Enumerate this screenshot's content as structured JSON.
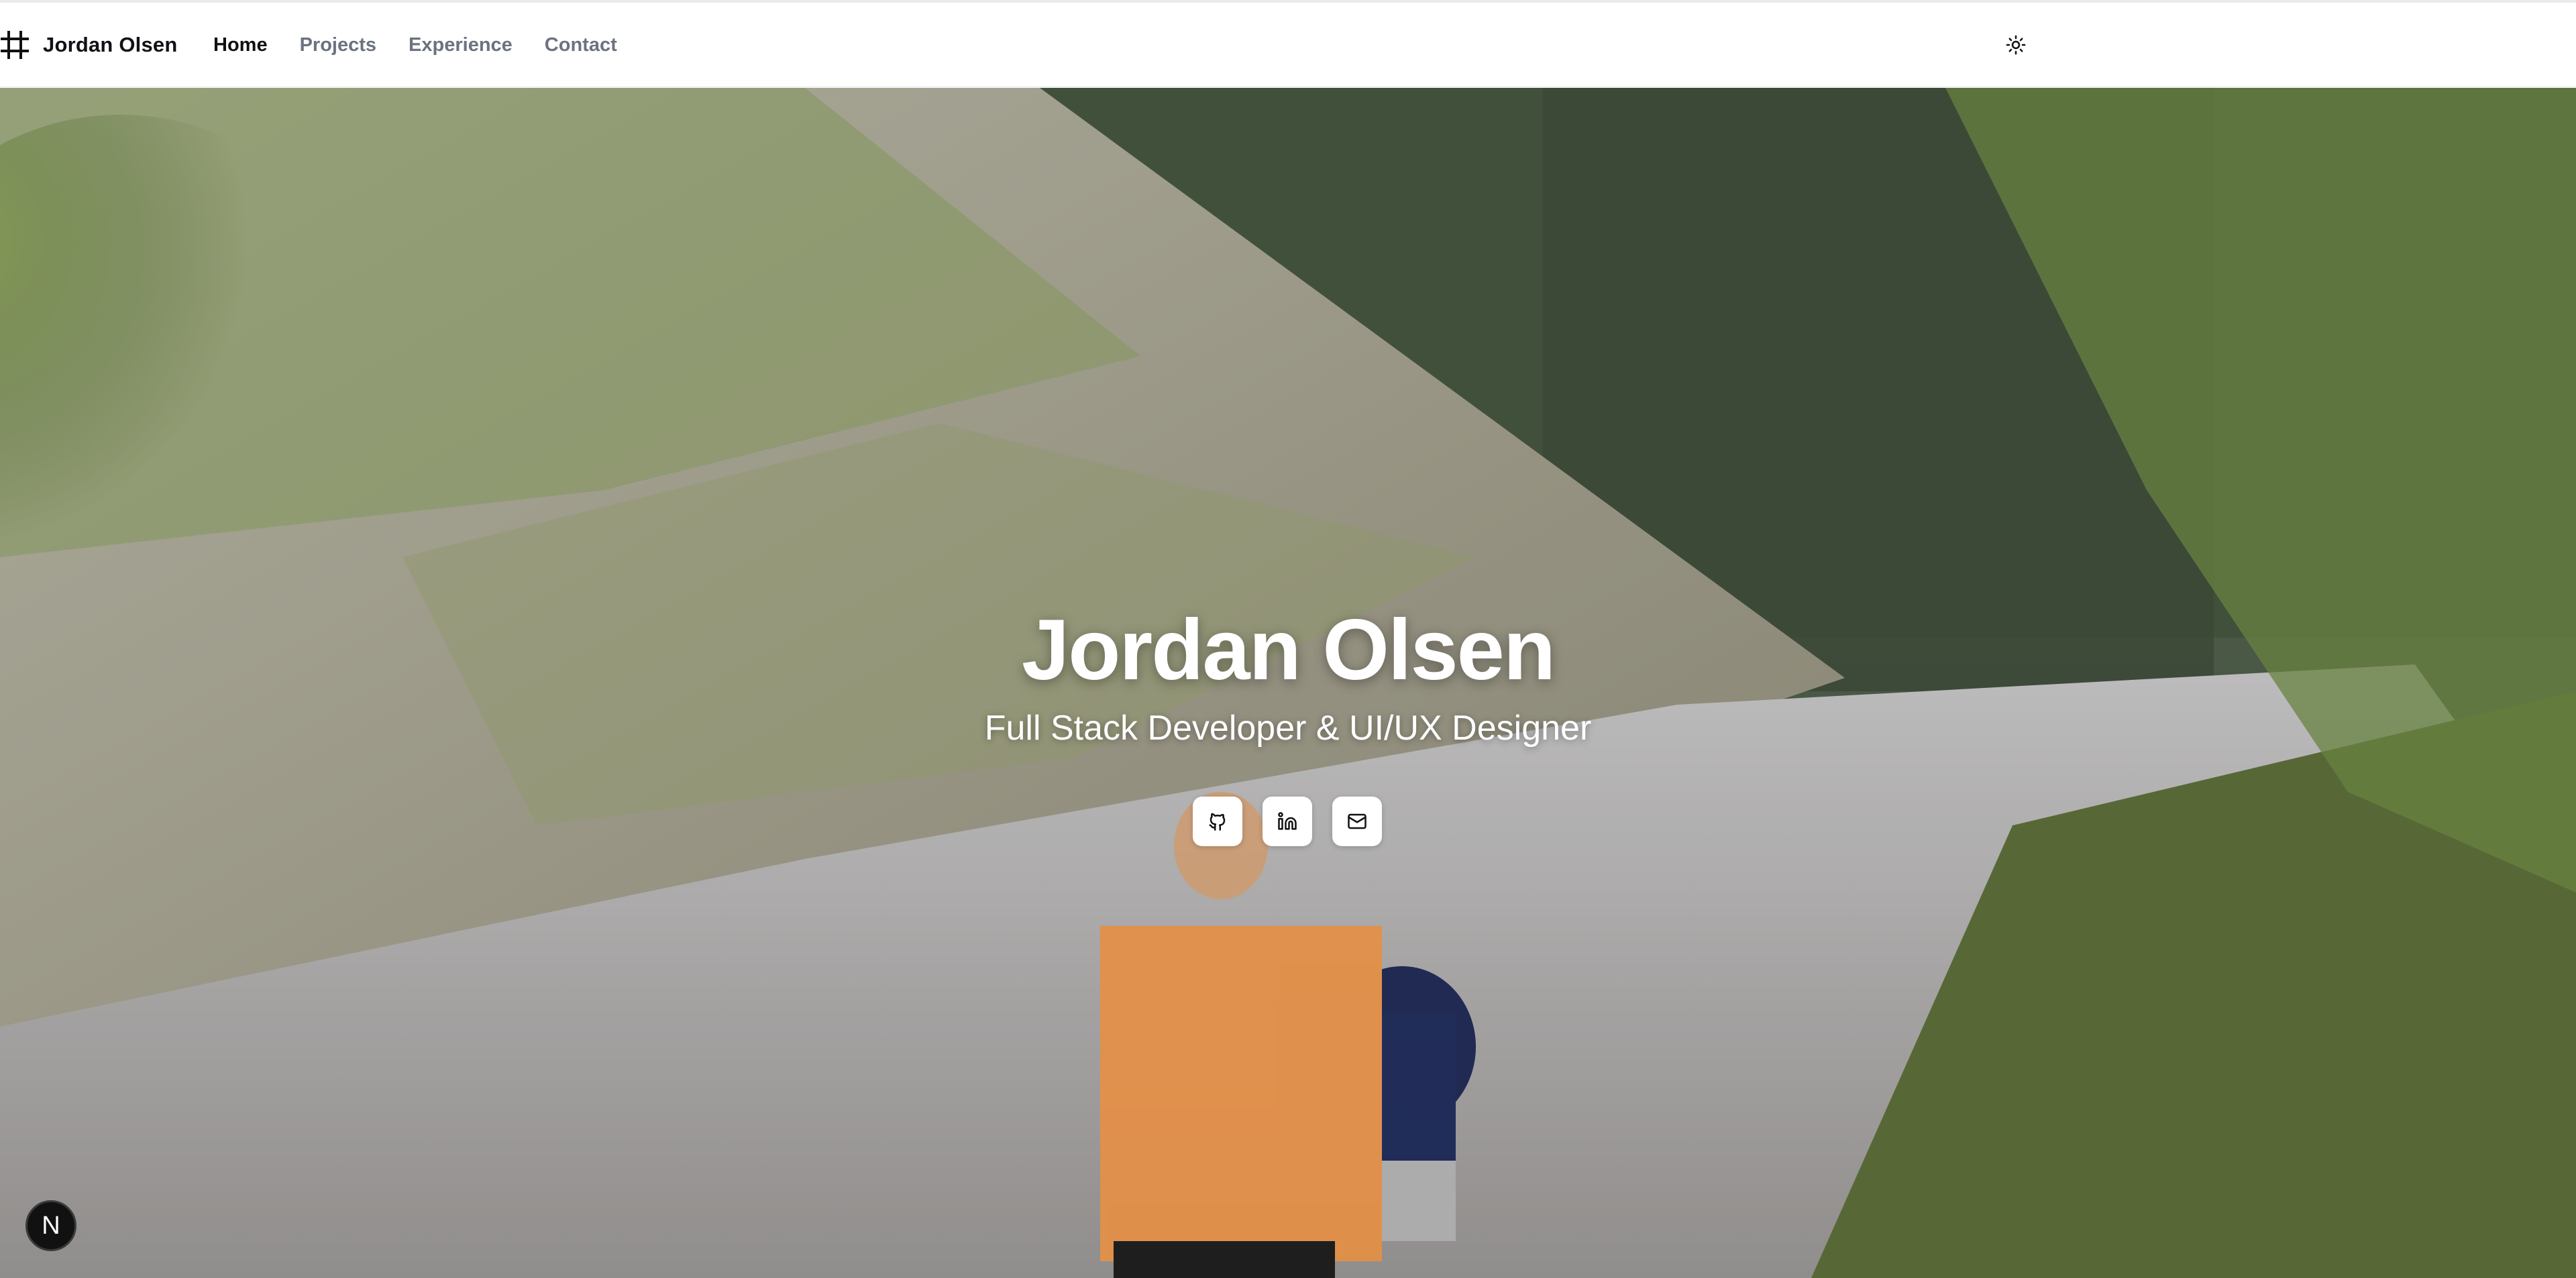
{
  "header": {
    "brand_name": "Jordan Olsen",
    "brand_icon": "hash-grid-icon",
    "nav": [
      {
        "label": "Home",
        "active": true
      },
      {
        "label": "Projects",
        "active": false
      },
      {
        "label": "Experience",
        "active": false
      },
      {
        "label": "Contact",
        "active": false
      }
    ],
    "theme_icon": "sun-icon"
  },
  "hero": {
    "title": "Jordan Olsen",
    "subtitle": "Full Stack Developer & UI/UX Designer",
    "socials": [
      {
        "icon": "github-icon"
      },
      {
        "icon": "linkedin-icon"
      },
      {
        "icon": "mail-icon"
      }
    ]
  },
  "badge": {
    "label": "N"
  },
  "colors": {
    "text_primary": "#0f1115",
    "nav_muted": "#6b7280",
    "hero_text": "#ffffff",
    "button_bg": "#ffffff",
    "badge_bg": "#111111"
  }
}
